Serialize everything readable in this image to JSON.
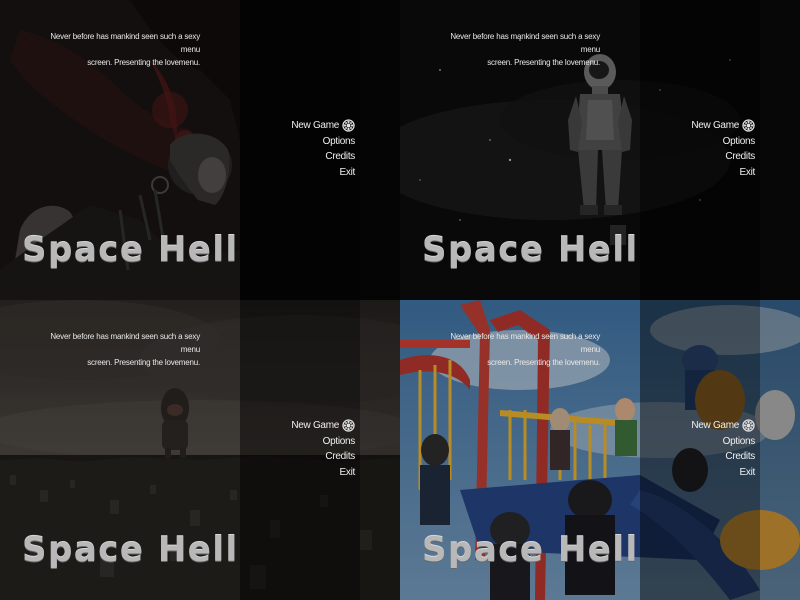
{
  "game": {
    "title": "Space Hell",
    "tagline_line1": "Never before has mankind seen such a sexy menu",
    "tagline_line2": "screen. Presenting the lovemenu."
  },
  "menu": {
    "items": [
      {
        "label": "New Game",
        "selected": true
      },
      {
        "label": "Options",
        "selected": false
      },
      {
        "label": "Credits",
        "selected": false
      },
      {
        "label": "Exit",
        "selected": false
      }
    ]
  },
  "panels": [
    {
      "id": "angel",
      "theme": "dark red grunge illustration of a winged figure"
    },
    {
      "id": "astronaut",
      "theme": "astronaut in space"
    },
    {
      "id": "city",
      "theme": "giant creature over a city"
    },
    {
      "id": "playground",
      "theme": "zombies at a playground"
    }
  ],
  "colors": {
    "menu_text": "#f0f0f0",
    "title_text": "#b8b8b8",
    "tagline_text": "#e8e8e8"
  },
  "icons": {
    "selection_marker": "gear-icon"
  }
}
